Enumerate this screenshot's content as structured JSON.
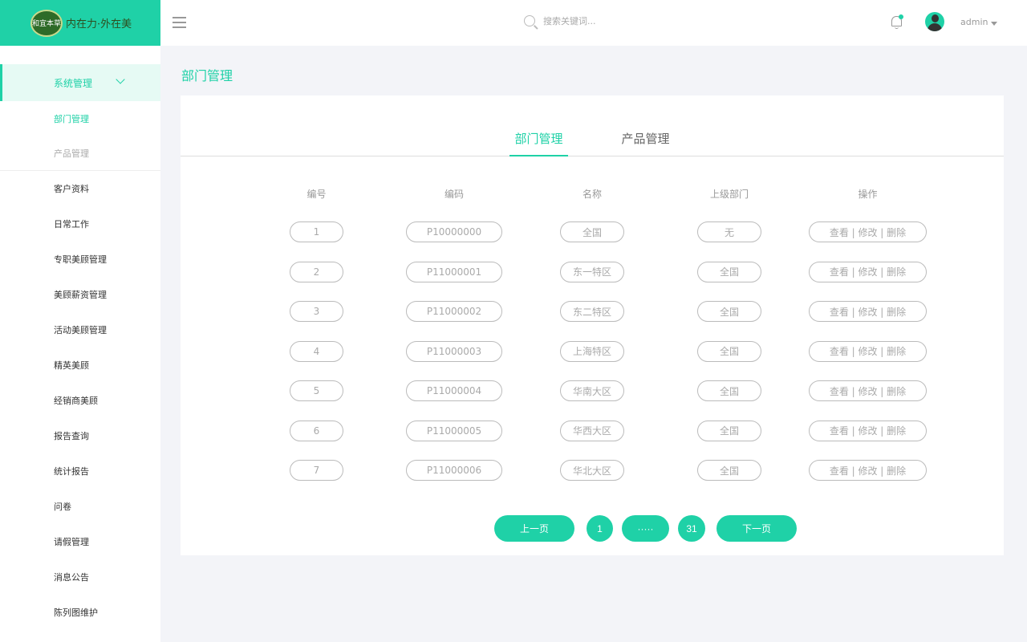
{
  "brand": {
    "logo_text": "和宜本草",
    "slogan": "内在力·外在美"
  },
  "sidebar": {
    "group": {
      "label": "系统管理"
    },
    "sub_items": [
      {
        "label": "部门管理",
        "active": true
      },
      {
        "label": "产品管理",
        "active": false
      }
    ],
    "items": [
      {
        "label": "客户资料"
      },
      {
        "label": "日常工作"
      },
      {
        "label": "专职美顾管理"
      },
      {
        "label": "美顾薪资管理"
      },
      {
        "label": "活动美顾管理"
      },
      {
        "label": "精英美顾"
      },
      {
        "label": "经销商美顾"
      },
      {
        "label": "报告查询"
      },
      {
        "label": "统计报告"
      },
      {
        "label": "问卷"
      },
      {
        "label": "请假管理"
      },
      {
        "label": "消息公告"
      },
      {
        "label": "陈列图维护"
      }
    ]
  },
  "header": {
    "search_placeholder": "搜索关键词...",
    "user_name": "admin"
  },
  "main": {
    "page_title": "部门管理",
    "tabs": [
      {
        "label": "部门管理",
        "active": true
      },
      {
        "label": "产品管理",
        "active": false
      }
    ],
    "columns": [
      "编号",
      "编码",
      "名称",
      "上级部门",
      "操作"
    ],
    "rows": [
      {
        "id": "1",
        "code": "P10000000",
        "name": "全国",
        "parent": "无",
        "action": "查看 | 修改 | 删除"
      },
      {
        "id": "2",
        "code": "P11000001",
        "name": "东一特区",
        "parent": "全国",
        "action": "查看 | 修改 | 删除"
      },
      {
        "id": "3",
        "code": "P11000002",
        "name": "东二特区",
        "parent": "全国",
        "action": "查看 | 修改 | 删除"
      },
      {
        "id": "4",
        "code": "P11000003",
        "name": "上海特区",
        "parent": "全国",
        "action": "查看 | 修改 | 删除"
      },
      {
        "id": "5",
        "code": "P11000004",
        "name": "华南大区",
        "parent": "全国",
        "action": "查看 | 修改 | 删除"
      },
      {
        "id": "6",
        "code": "P11000005",
        "name": "华西大区",
        "parent": "全国",
        "action": "查看 | 修改 | 删除"
      },
      {
        "id": "7",
        "code": "P11000006",
        "name": "华北大区",
        "parent": "全国",
        "action": "查看 | 修改 | 删除"
      }
    ],
    "pagination": {
      "prev": "上一页",
      "first": "1",
      "ellipsis": "·····",
      "last": "31",
      "next": "下一页"
    }
  },
  "colors": {
    "accent": "#1fd1a7",
    "background": "#f3f4f8"
  }
}
